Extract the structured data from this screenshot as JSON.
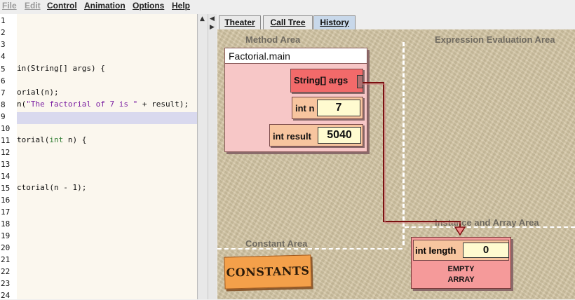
{
  "menubar": {
    "items": [
      {
        "label": "File",
        "enabled": false
      },
      {
        "label": "Edit",
        "enabled": false
      },
      {
        "label": "Control",
        "enabled": true
      },
      {
        "label": "Animation",
        "enabled": true
      },
      {
        "label": "Options",
        "enabled": true
      },
      {
        "label": "Help",
        "enabled": true
      }
    ]
  },
  "editor": {
    "line_numbers": [
      "1",
      "2",
      "3",
      "4",
      "5",
      "6",
      "7",
      "8",
      "9",
      "10",
      "11",
      "12",
      "13",
      "14",
      "15",
      "16",
      "17",
      "18",
      "19",
      "20",
      "21",
      "22",
      "23",
      "24"
    ],
    "highlighted_line": "8",
    "lines": {
      "l5": "in(String[] args) {",
      "l7": "orial(n);",
      "l8_prefix": "n(",
      "l8_string": "\"The factorial of 7 is \"",
      "l8_suffix": " + result);",
      "l11_prefix": "torial(",
      "l11_keyword": "int",
      "l11_suffix": " n) {",
      "l15": "ctorial(n - 1);"
    }
  },
  "tabs": [
    {
      "label": "Theater",
      "active": false
    },
    {
      "label": "Call Tree",
      "active": false
    },
    {
      "label": "History",
      "active": true
    }
  ],
  "theater": {
    "areas": {
      "method": "Method Area",
      "expression": "Expression Evaluation Area",
      "constant": "Constant Area",
      "instance": "Instance and Array Area"
    },
    "frame": {
      "title": "Factorial.main",
      "variables": [
        {
          "label": "String[] args",
          "value": ""
        },
        {
          "label": "int n",
          "value": "7"
        },
        {
          "label": "int result",
          "value": "5040"
        }
      ]
    },
    "constants_label": "CONSTANTS",
    "array": {
      "length_label": "int length",
      "length_value": "0",
      "status_line1": "EMPTY",
      "status_line2": "ARRAY"
    }
  },
  "colors": {
    "frame_bg": "#f7c7c7",
    "args_var_bg": "#f26a6a",
    "var_bg": "#f7c59f",
    "value_bg": "#fffbd0",
    "reference_arrow": "#7a1010",
    "constants_bg": "#f4a04a",
    "array_bg": "#f59a9a",
    "stage_bg": "#d4c6a4",
    "active_tab": "#c8d8ea",
    "code_highlight": "#d9d9ee"
  }
}
